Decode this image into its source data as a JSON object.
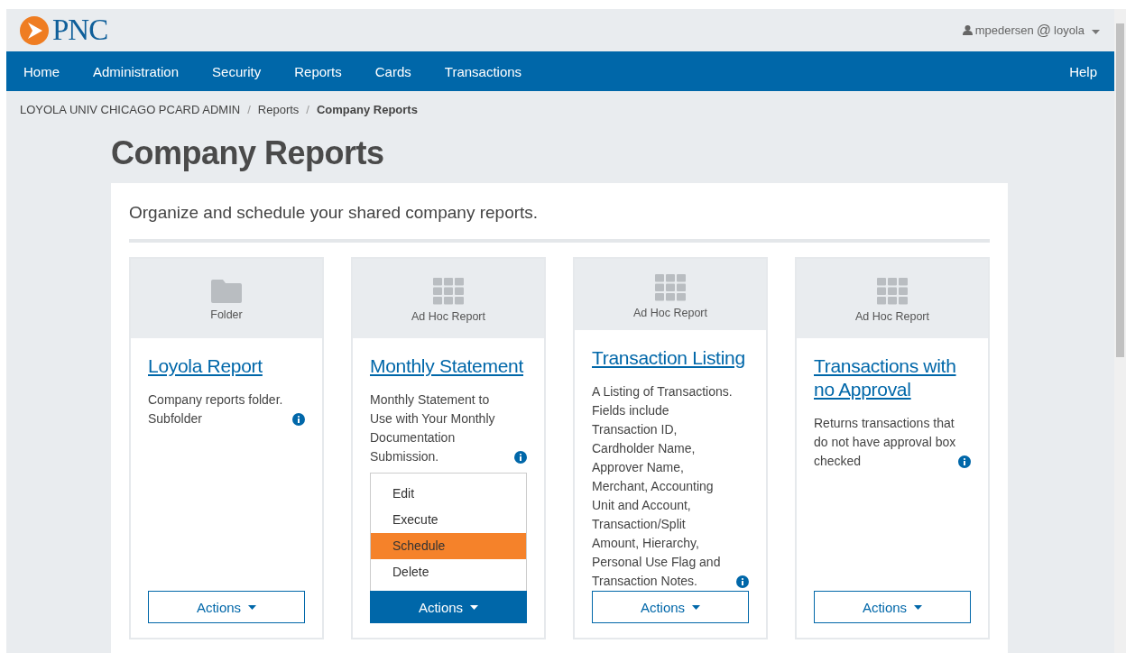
{
  "header": {
    "logo": "PNC",
    "user": {
      "name": "mpedersen",
      "at": "@",
      "org": "loyola"
    }
  },
  "nav": {
    "items": [
      {
        "label": "Home",
        "selected": false
      },
      {
        "label": "Administration",
        "selected": false
      },
      {
        "label": "Security",
        "selected": false
      },
      {
        "label": "Reports",
        "selected": false
      },
      {
        "label": "Cards",
        "selected": false
      },
      {
        "label": "Transactions",
        "selected": false
      }
    ],
    "help": "Help"
  },
  "breadcrumb": [
    {
      "label": "LOYOLA UNIV CHICAGO PCARD ADMIN",
      "current": false
    },
    {
      "label": "Reports",
      "current": false
    },
    {
      "label": "Company Reports",
      "current": true
    }
  ],
  "breadcrumb_separator": "/",
  "page_title": "Company Reports",
  "intro": "Organize and schedule your shared company reports.",
  "cards": [
    {
      "kind": "folder",
      "type_label": "Folder",
      "title": "Loyola Report",
      "description": "Company reports folder. Subfolder",
      "actions": "Actions",
      "menu_open": false
    },
    {
      "kind": "grid",
      "type_label": "Ad Hoc Report",
      "title": "Monthly Statement",
      "description": "Monthly Statement to Use with Your Monthly Documentation Submission.",
      "actions": "Actions",
      "menu_open": true,
      "menu": [
        {
          "label": "Edit",
          "selected": false
        },
        {
          "label": "Execute",
          "selected": false
        },
        {
          "label": "Schedule",
          "selected": true
        },
        {
          "label": "Delete",
          "selected": false
        }
      ]
    },
    {
      "kind": "grid",
      "type_label": "Ad Hoc Report",
      "title": "Transaction Listing",
      "description": "A Listing of Transactions. Fields include Transaction ID, Cardholder Name, Approver Name, Merchant, Accounting Unit and Account, Transaction/Split Amount, Hierarchy, Personal Use Flag and Transaction Notes.",
      "actions": "Actions",
      "menu_open": false
    },
    {
      "kind": "grid",
      "type_label": "Ad Hoc Report",
      "title": "Transactions with no Approval",
      "description": "Returns transactions that do not have approval box checked",
      "actions": "Actions",
      "menu_open": false
    }
  ]
}
